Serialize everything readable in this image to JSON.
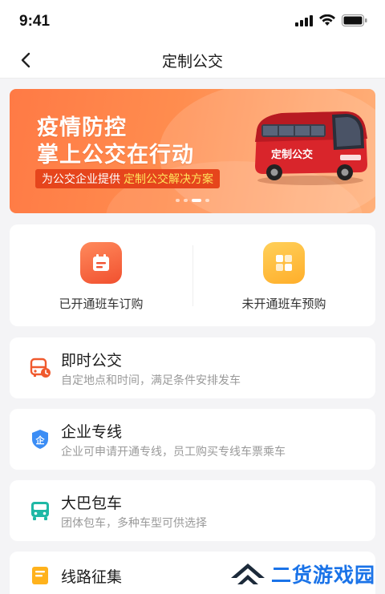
{
  "status": {
    "time": "9:41"
  },
  "nav": {
    "title": "定制公交"
  },
  "banner": {
    "line1": "疫情防控",
    "line2": "掌上公交在行动",
    "tag_prefix": "为公交企业提供",
    "tag_highlight": "定制公交解决方案",
    "bus_label": "定制公交",
    "slide_count": 4,
    "active_slide": 3
  },
  "purchase": [
    {
      "label": "已开通班车订购",
      "icon": "calendar-icon",
      "color": "#f1502f"
    },
    {
      "label": "未开通班车预购",
      "icon": "grid-icon",
      "color": "#ffae2a"
    }
  ],
  "services": [
    {
      "title": "即时公交",
      "subtitle": "自定地点和时间，满足条件安排发车",
      "icon": "bus-clock-icon"
    },
    {
      "title": "企业专线",
      "subtitle": "企业可申请开通专线，员工购买专线车票乘车",
      "icon": "enterprise-shield-icon",
      "badge": "企"
    },
    {
      "title": "大巴包车",
      "subtitle": "团体包车，多种车型可供选择",
      "icon": "bus-icon"
    },
    {
      "title": "线路征集",
      "subtitle": "",
      "icon": "document-icon"
    }
  ],
  "watermark": {
    "text": "二货游戏园"
  },
  "colors": {
    "accent": "#ff7a45",
    "blue": "#3b8df5",
    "teal": "#1fb8a5",
    "yellow": "#ffb21c"
  }
}
